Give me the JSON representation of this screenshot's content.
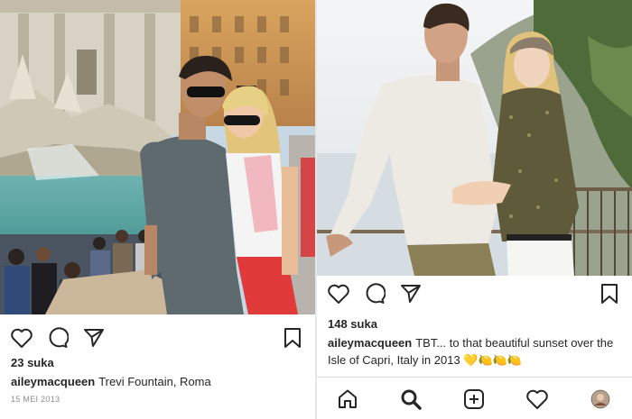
{
  "posts": [
    {
      "likes": "23 suka",
      "username": "aileymacqueen",
      "caption": "Trevi Fountain, Roma",
      "date": "15 MEI 2013"
    },
    {
      "likes": "148 suka",
      "username": "aileymacqueen",
      "caption": "TBT... to that beautiful sunset over the Isle of Capri, Italy in 2013 💛🍋🍋🍋"
    }
  ],
  "icons": {
    "like": "heart-icon",
    "comment": "comment-icon",
    "share": "paper-plane-icon",
    "save": "bookmark-icon",
    "home": "home-icon",
    "search": "search-icon",
    "new_post": "plus-square-icon",
    "activity": "heart-icon",
    "profile": "avatar"
  },
  "colors": {
    "text": "#262626",
    "muted": "#8e8e8e",
    "border": "#dbdbdb"
  }
}
